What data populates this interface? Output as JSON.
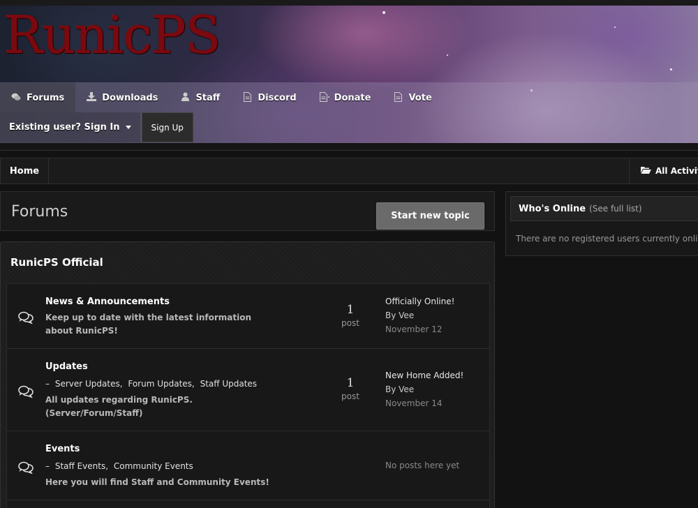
{
  "site": {
    "logo": "RunicPS"
  },
  "nav": {
    "items": [
      {
        "label": "Forums",
        "icon": "comments-icon"
      },
      {
        "label": "Downloads",
        "icon": "download-icon"
      },
      {
        "label": "Staff",
        "icon": "user-icon"
      },
      {
        "label": "Discord",
        "icon": "document-icon"
      },
      {
        "label": "Donate",
        "icon": "document-icon"
      },
      {
        "label": "Vote",
        "icon": "document-icon"
      }
    ]
  },
  "userbar": {
    "sign_in": "Existing user? Sign In",
    "sign_up": "Sign Up"
  },
  "breadcrumb": {
    "home": "Home",
    "all_activity": "All Activity"
  },
  "page": {
    "title": "Forums",
    "new_topic": "Start new topic"
  },
  "category": {
    "title": "RunicPS Official",
    "forums": [
      {
        "title": "News & Announcements",
        "description": "Keep up to date with the latest information about RunicPS!",
        "subforums": [],
        "count": "1",
        "count_label": "post",
        "last_title": "Officially Online!",
        "last_by": "By Vee",
        "last_date": "November 12"
      },
      {
        "title": "Updates",
        "subforums_prefix": "–",
        "subforums": [
          "Server Updates,",
          "Forum Updates,",
          "Staff Updates"
        ],
        "description": "All updates regarding RunicPS. (Server/Forum/Staff)",
        "count": "1",
        "count_label": "post",
        "last_title": "New Home Added!",
        "last_by": "By Vee",
        "last_date": "November 14"
      },
      {
        "title": "Events",
        "subforums_prefix": "–",
        "subforums": [
          "Staff Events,",
          "Community Events"
        ],
        "description": "Here you will find Staff and Community Events!",
        "empty": "No posts here yet"
      }
    ]
  },
  "sidebar": {
    "whos_online_title": "Who's Online",
    "whos_online_link": "(See full list)",
    "whos_online_body": "There are no registered users currently online"
  }
}
